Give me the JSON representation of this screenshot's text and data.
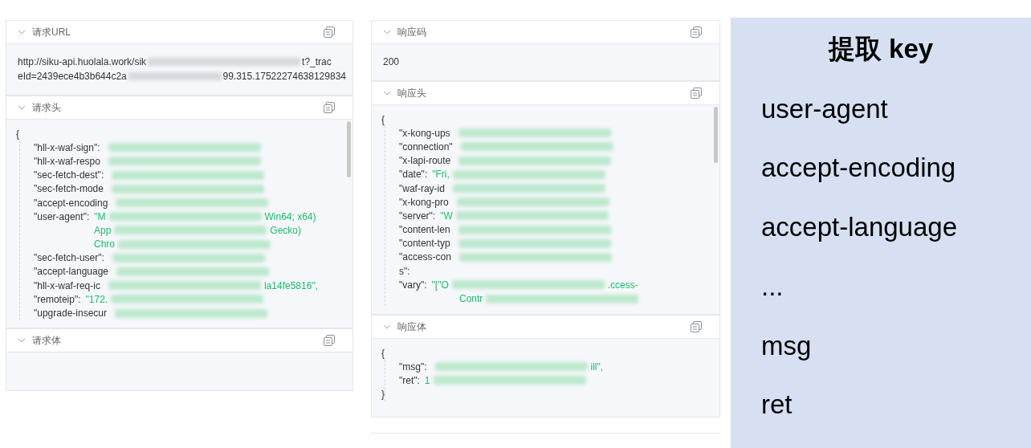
{
  "columns": [
    {
      "sections": [
        {
          "title": "请求URL",
          "kind": "text",
          "lines": [
            {
              "text": "http://siku-api.huolala.work/sik",
              "tail": "t?_trac"
            },
            {
              "text": "eId=2439ece4b3b644c2a",
              "tail": "99.315.17522274638129834"
            }
          ]
        },
        {
          "title": "请求头",
          "kind": "code",
          "scrollbar": true,
          "lines": [
            {
              "kind": "brace",
              "text": "{"
            },
            {
              "kind": "entry",
              "key": "\"hll-x-waf-sign\":",
              "redacted": true
            },
            {
              "kind": "entry",
              "key": "\"hll-x-waf-respo",
              "redacted": true
            },
            {
              "kind": "entry",
              "key": "\"sec-fetch-dest\":",
              "redacted": true
            },
            {
              "kind": "entry",
              "key": "\"sec-fetch-mode",
              "redacted": true
            },
            {
              "kind": "entry",
              "key": "\"accept-encoding",
              "redacted": true
            },
            {
              "kind": "entry",
              "key": "\"user-agent\":",
              "value": "\"M",
              "redacted": true,
              "tail": "Win64; x64)"
            },
            {
              "kind": "continuation",
              "value": "App",
              "redacted": true,
              "tail": "Gecko)"
            },
            {
              "kind": "continuation",
              "value": "Chro",
              "redacted": true
            },
            {
              "kind": "entry",
              "key": "\"sec-fetch-user\":",
              "redacted": true
            },
            {
              "kind": "entry",
              "key": "\"accept-language",
              "redacted": true
            },
            {
              "kind": "entry",
              "key": "\"hll-x-waf-req-ic",
              "redacted": true,
              "tail": "la14fe5816\","
            },
            {
              "kind": "entry",
              "key": "\"remoteip\":",
              "value": "\"172.",
              "redacted": true
            },
            {
              "kind": "entry",
              "key": "\"upgrade-insecur",
              "redacted": true
            }
          ]
        },
        {
          "title": "请求体",
          "kind": "empty"
        }
      ]
    },
    {
      "sections": [
        {
          "title": "响应码",
          "kind": "text",
          "lines": [
            {
              "text": "200"
            }
          ]
        },
        {
          "title": "响应头",
          "kind": "code",
          "scrollbar": true,
          "lines": [
            {
              "kind": "brace",
              "text": "{"
            },
            {
              "kind": "entry",
              "key": "\"x-kong-ups",
              "redacted": true
            },
            {
              "kind": "entry",
              "key": "\"connection\"",
              "redacted": true
            },
            {
              "kind": "entry",
              "key": "\"x-lapi-route",
              "redacted": true
            },
            {
              "kind": "entry",
              "key": "\"date\":",
              "value": "\"Fri,",
              "redacted": true
            },
            {
              "kind": "entry",
              "key": "\"waf-ray-id",
              "redacted": true
            },
            {
              "kind": "entry",
              "key": "\"x-kong-pro",
              "redacted": true
            },
            {
              "kind": "entry",
              "key": "\"server\":",
              "value": "\"W",
              "redacted": true
            },
            {
              "kind": "entry",
              "key": "\"content-len",
              "redacted": true
            },
            {
              "kind": "entry",
              "key": "\"content-typ",
              "redacted": true
            },
            {
              "kind": "entry",
              "key": "\"access-con",
              "redacted": true
            },
            {
              "kind": "entry",
              "key": "s\":",
              "redacted": false
            },
            {
              "kind": "entry",
              "key": "\"vary\":",
              "value": "\"[\"O",
              "redacted": true,
              "tail": ".ccess-"
            },
            {
              "kind": "continuation",
              "value": "Contr",
              "redacted": true
            }
          ]
        },
        {
          "title": "响应体",
          "kind": "code",
          "scrollbar": false,
          "lines": [
            {
              "kind": "brace",
              "text": "{"
            },
            {
              "kind": "entry",
              "key": "\"msg\":",
              "redacted": true,
              "tail": "ill\","
            },
            {
              "kind": "entry",
              "key": "\"ret\":",
              "value": "1",
              "redacted": true
            },
            {
              "kind": "brace",
              "text": "}"
            }
          ]
        }
      ]
    }
  ],
  "panel": {
    "title": "提取 key",
    "items": [
      "user-agent",
      "accept-encoding",
      "accept-language",
      "...",
      "msg",
      "ret"
    ]
  }
}
